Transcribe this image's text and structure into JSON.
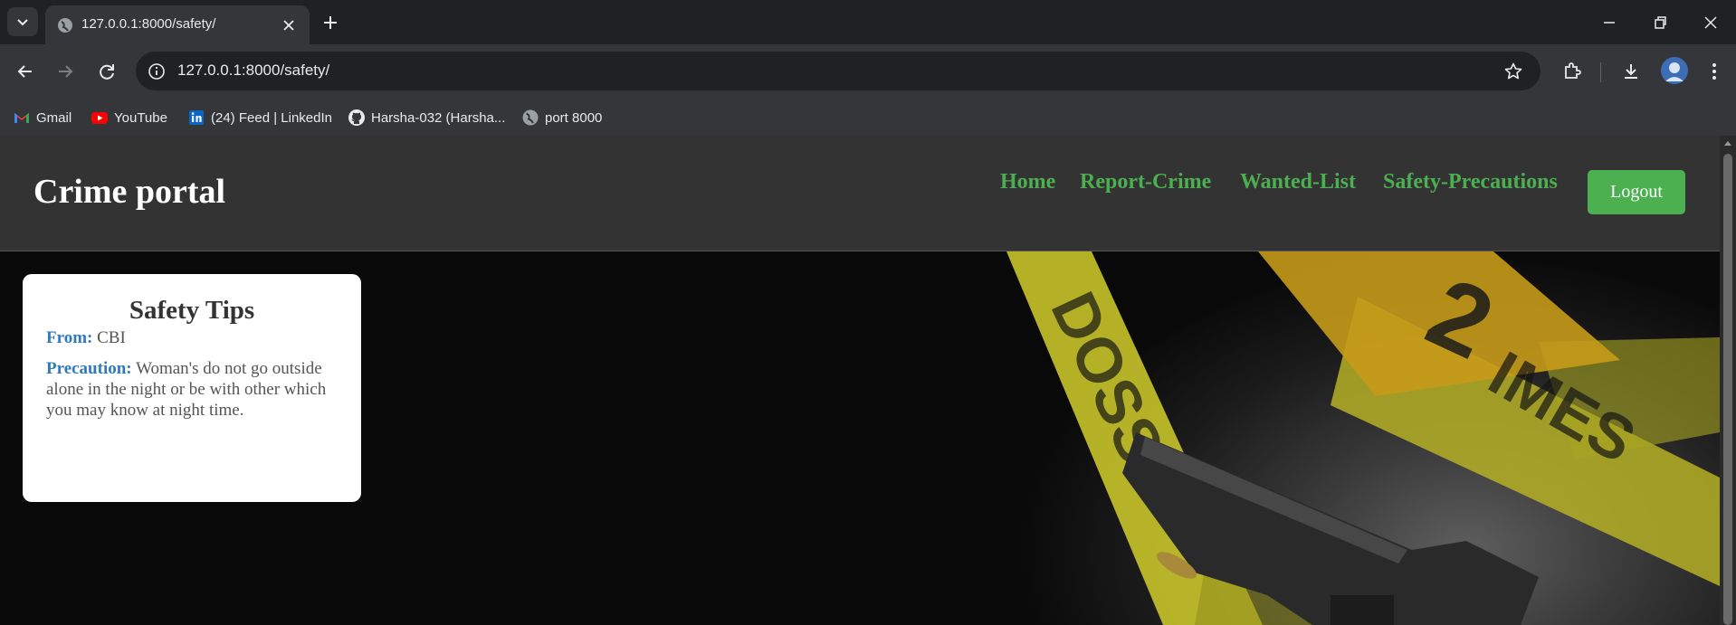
{
  "browser": {
    "tab_title": "127.0.0.1:8000/safety/",
    "url": "127.0.0.1:8000/safety/",
    "bookmarks": [
      {
        "label": "Gmail",
        "icon": "gmail-icon"
      },
      {
        "label": "YouTube",
        "icon": "youtube-icon"
      },
      {
        "label": "(24) Feed | LinkedIn",
        "icon": "linkedin-icon"
      },
      {
        "label": "Harsha-032 (Harsha...",
        "icon": "github-icon"
      },
      {
        "label": "port 8000",
        "icon": "globe-icon"
      }
    ]
  },
  "site": {
    "brand": "Crime portal",
    "nav": [
      {
        "label": "Home"
      },
      {
        "label": "Report-Crime"
      },
      {
        "label": "Wanted-List"
      },
      {
        "label": "Safety-Precautions"
      }
    ],
    "logout_label": "Logout",
    "accent_color": "#4caf50"
  },
  "card": {
    "title": "Safety Tips",
    "from_label": "From:",
    "from_value": "CBI",
    "precaution_label": "Precaution:",
    "precaution_value": "Woman's do not go outside alone in the night or be with other which you may know at night time."
  }
}
